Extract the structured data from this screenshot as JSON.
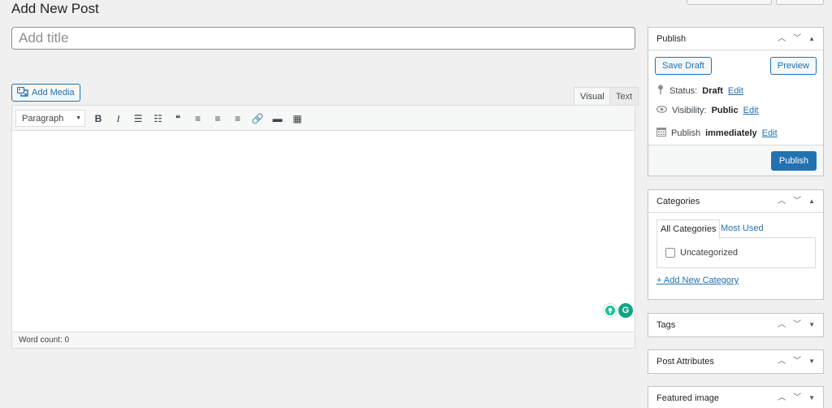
{
  "header": {
    "title": "Add New Post"
  },
  "title_field": {
    "placeholder": "Add title",
    "value": ""
  },
  "media": {
    "add_media_label": "Add Media"
  },
  "editor": {
    "tabs": [
      {
        "label": "Visual",
        "active": true
      },
      {
        "label": "Text",
        "active": false
      }
    ],
    "format_select": "Paragraph",
    "toolbar": [
      {
        "name": "bold-button",
        "glyph": "B"
      },
      {
        "name": "italic-button",
        "glyph": "I"
      },
      {
        "name": "bulleted-list-button",
        "glyph": "☰"
      },
      {
        "name": "numbered-list-button",
        "glyph": "☷"
      },
      {
        "name": "blockquote-button",
        "glyph": "❝"
      },
      {
        "name": "align-left-button",
        "glyph": "≡"
      },
      {
        "name": "align-center-button",
        "glyph": "≡"
      },
      {
        "name": "align-right-button",
        "glyph": "≡"
      },
      {
        "name": "insert-link-button",
        "glyph": "🔗"
      },
      {
        "name": "read-more-button",
        "glyph": "▬"
      },
      {
        "name": "toolbar-toggle-button",
        "glyph": "▦"
      }
    ],
    "word_count": "Word count: 0"
  },
  "publish": {
    "title": "Publish",
    "save_draft": "Save Draft",
    "preview": "Preview",
    "status_label": "Status:",
    "status_value": "Draft",
    "visibility_label": "Visibility:",
    "visibility_value": "Public",
    "publish_label": "Publish",
    "publish_value": "immediately",
    "edit": "Edit",
    "publish_button": "Publish"
  },
  "categories": {
    "title": "Categories",
    "tab_all": "All Categories",
    "tab_used": "Most Used",
    "items": [
      {
        "label": "Uncategorized",
        "checked": false
      }
    ],
    "add_link": "+ Add New Category"
  },
  "panels": {
    "tags": "Tags",
    "post_attributes": "Post Attributes",
    "featured_image": "Featured image"
  },
  "colors": {
    "accent": "#2271b1",
    "background": "#f0f0f1"
  }
}
